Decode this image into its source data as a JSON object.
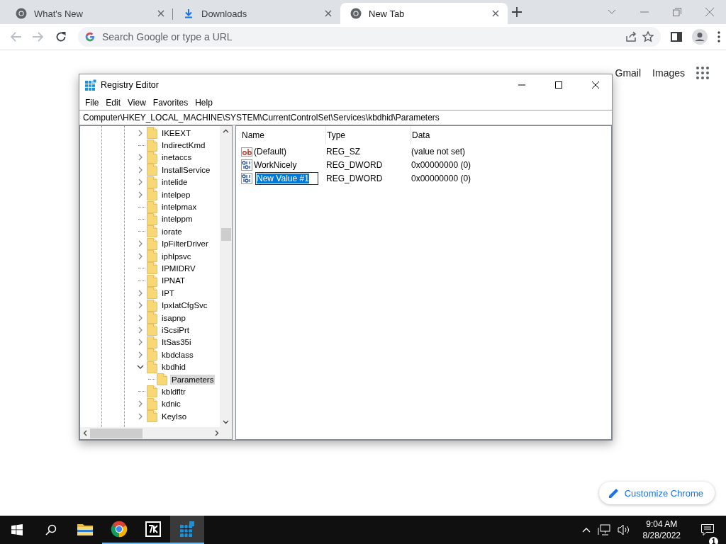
{
  "browser": {
    "tabs": [
      {
        "title": "What's New",
        "kind": "browser",
        "selected": false
      },
      {
        "title": "Downloads",
        "kind": "downloads",
        "selected": false
      },
      {
        "title": "New Tab",
        "kind": "browser",
        "selected": true
      }
    ],
    "back": {
      "disabled": true
    },
    "forward": {
      "disabled": true
    },
    "omnibox": {
      "placeholder": "Search Google or type a URL"
    }
  },
  "new_tab_page": {
    "links": [
      "Gmail",
      "Images"
    ],
    "customize_button": "Customize Chrome"
  },
  "registry_editor": {
    "title": "Registry Editor",
    "menu": [
      "File",
      "Edit",
      "View",
      "Favorites",
      "Help"
    ],
    "address": "Computer\\HKEY_LOCAL_MACHINE\\SYSTEM\\CurrentControlSet\\Services\\kbdhid\\Parameters",
    "tree": [
      {
        "label": "IKEEXT",
        "kind": "collapsed",
        "selected": false
      },
      {
        "label": "IndirectKmd",
        "kind": "leaf",
        "selected": false
      },
      {
        "label": "inetaccs",
        "kind": "collapsed",
        "selected": false
      },
      {
        "label": "InstallService",
        "kind": "collapsed",
        "selected": false
      },
      {
        "label": "intelide",
        "kind": "collapsed",
        "selected": false
      },
      {
        "label": "intelpep",
        "kind": "collapsed",
        "selected": false
      },
      {
        "label": "intelpmax",
        "kind": "leaf",
        "selected": false
      },
      {
        "label": "intelppm",
        "kind": "leaf",
        "selected": false
      },
      {
        "label": "iorate",
        "kind": "leaf",
        "selected": false
      },
      {
        "label": "IpFilterDriver",
        "kind": "collapsed",
        "selected": false
      },
      {
        "label": "iphlpsvc",
        "kind": "collapsed",
        "selected": false
      },
      {
        "label": "IPMIDRV",
        "kind": "leaf",
        "selected": false
      },
      {
        "label": "IPNAT",
        "kind": "leaf",
        "selected": false
      },
      {
        "label": "IPT",
        "kind": "collapsed",
        "selected": false
      },
      {
        "label": "IpxlatCfgSvc",
        "kind": "collapsed",
        "selected": false
      },
      {
        "label": "isapnp",
        "kind": "collapsed",
        "selected": false
      },
      {
        "label": "iScsiPrt",
        "kind": "collapsed",
        "selected": false
      },
      {
        "label": "ItSas35i",
        "kind": "collapsed",
        "selected": false
      },
      {
        "label": "kbdclass",
        "kind": "collapsed",
        "selected": false
      },
      {
        "label": "kbdhid",
        "kind": "expanded",
        "selected": false,
        "children": [
          {
            "label": "Parameters",
            "kind": "leaf",
            "selected": true
          }
        ]
      },
      {
        "label": "kbldfltr",
        "kind": "leaf",
        "selected": false
      },
      {
        "label": "kdnic",
        "kind": "collapsed",
        "selected": false
      },
      {
        "label": "KeyIso",
        "kind": "collapsed",
        "selected": false
      }
    ],
    "columns": [
      "Name",
      "Type",
      "Data"
    ],
    "values": [
      {
        "name": "(Default)",
        "kind": "string",
        "type": "REG_SZ",
        "data": "(value not set)",
        "editing": false
      },
      {
        "name": "WorkNicely",
        "kind": "dword",
        "type": "REG_DWORD",
        "data": "0x00000000 (0)",
        "editing": false
      },
      {
        "name": "New Value #1",
        "kind": "dword",
        "type": "REG_DWORD",
        "data": "0x00000000 (0)",
        "editing": true
      }
    ]
  },
  "taskbar": {
    "apps": [
      {
        "kind": "explorer",
        "running": false,
        "active": false
      },
      {
        "kind": "chrome",
        "running": true,
        "active": false
      },
      {
        "kind": "archiver",
        "running": true,
        "active": false
      },
      {
        "kind": "regedit",
        "running": true,
        "active": true
      }
    ],
    "time": "9:04 AM",
    "date": "8/28/2022",
    "notification_count": "1"
  }
}
